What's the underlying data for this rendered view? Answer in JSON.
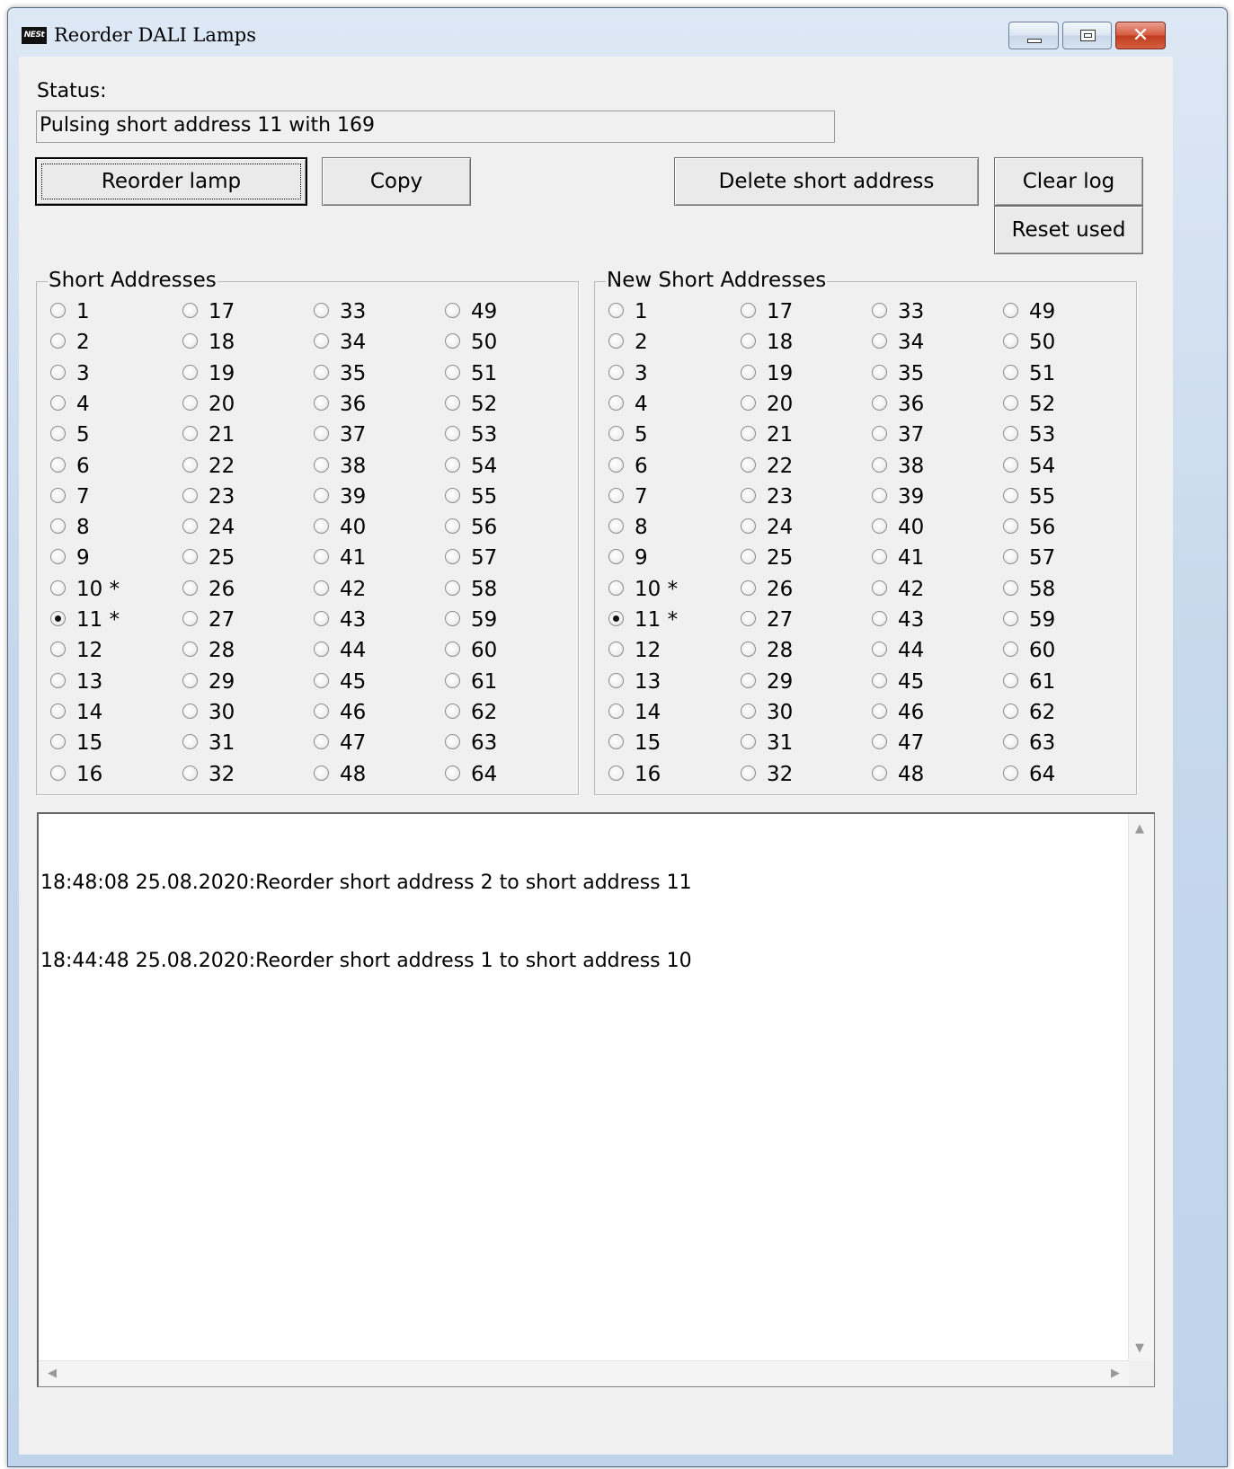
{
  "window": {
    "title": "Reorder DALI Lamps",
    "icon_text": "NESt"
  },
  "status": {
    "label": "Status:",
    "value": "Pulsing short address 11 with 169"
  },
  "buttons": {
    "reorder_lamp": "Reorder lamp",
    "copy": "Copy",
    "delete_short_address": "Delete short address",
    "clear_log": "Clear log",
    "reset_used": "Reset used"
  },
  "short_addresses": {
    "title": "Short Addresses",
    "items": [
      "1",
      "2",
      "3",
      "4",
      "5",
      "6",
      "7",
      "8",
      "9",
      "10 *",
      "11 *",
      "12",
      "13",
      "14",
      "15",
      "16",
      "17",
      "18",
      "19",
      "20",
      "21",
      "22",
      "23",
      "24",
      "25",
      "26",
      "27",
      "28",
      "29",
      "30",
      "31",
      "32",
      "33",
      "34",
      "35",
      "36",
      "37",
      "38",
      "39",
      "40",
      "41",
      "42",
      "43",
      "44",
      "45",
      "46",
      "47",
      "48",
      "49",
      "50",
      "51",
      "52",
      "53",
      "54",
      "55",
      "56",
      "57",
      "58",
      "59",
      "60",
      "61",
      "62",
      "63",
      "64"
    ],
    "selected": "11 *"
  },
  "new_short_addresses": {
    "title": "New Short Addresses",
    "items": [
      "1",
      "2",
      "3",
      "4",
      "5",
      "6",
      "7",
      "8",
      "9",
      "10 *",
      "11 *",
      "12",
      "13",
      "14",
      "15",
      "16",
      "17",
      "18",
      "19",
      "20",
      "21",
      "22",
      "23",
      "24",
      "25",
      "26",
      "27",
      "28",
      "29",
      "30",
      "31",
      "32",
      "33",
      "34",
      "35",
      "36",
      "37",
      "38",
      "39",
      "40",
      "41",
      "42",
      "43",
      "44",
      "45",
      "46",
      "47",
      "48",
      "49",
      "50",
      "51",
      "52",
      "53",
      "54",
      "55",
      "56",
      "57",
      "58",
      "59",
      "60",
      "61",
      "62",
      "63",
      "64"
    ],
    "selected": "11 *"
  },
  "log": {
    "lines": [
      "18:48:08 25.08.2020:Reorder short address 2 to short address 11",
      "18:44:48 25.08.2020:Reorder short address 1 to short address 10"
    ]
  },
  "icons": {
    "minimize": "minimize-icon",
    "maximize": "maximize-icon",
    "close": "close-icon",
    "close_glyph": "✕",
    "scroll_up": "▲",
    "scroll_down": "▼",
    "scroll_left": "◀",
    "scroll_right": "▶"
  },
  "colors": {
    "client_bg": "#f0f0f0",
    "close_button": "#c13a1f",
    "titlebar": "#c7d8ec"
  }
}
